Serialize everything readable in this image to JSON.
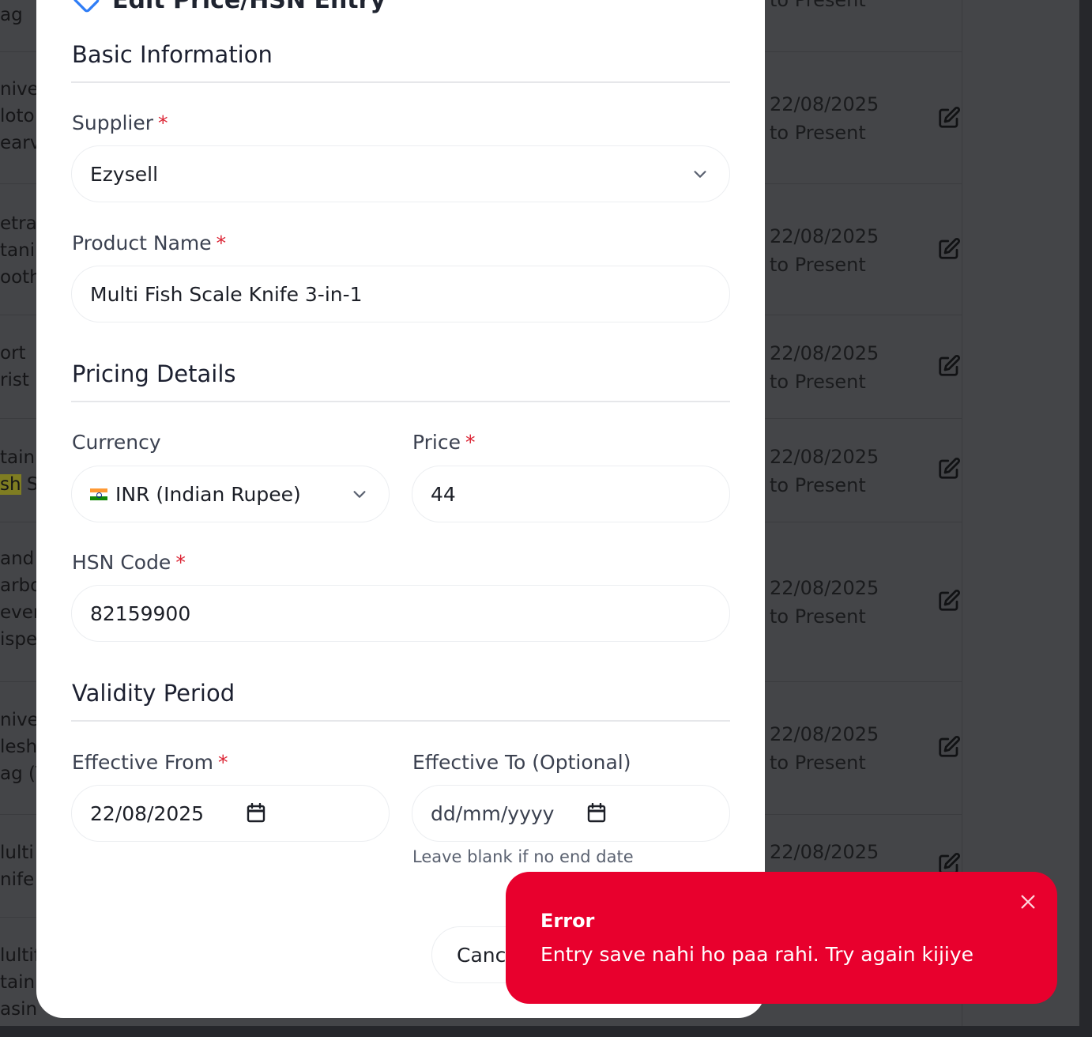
{
  "background": {
    "left_fragments": [
      {
        "lines": [
          "ag"
        ]
      },
      {
        "lines": [
          "nive",
          "loto",
          "earv"
        ]
      },
      {
        "lines": [
          "etra",
          "tani",
          "ooth"
        ]
      },
      {
        "lines": [
          "ort",
          "rist"
        ]
      },
      {
        "lines": [
          "tainl",
          "sh S"
        ],
        "highlight": "sh"
      },
      {
        "lines": [
          "and",
          "arbo",
          "ever",
          "ispe"
        ]
      },
      {
        "lines": [
          "nive",
          "lesh",
          "ag (T"
        ]
      },
      {
        "lines": [
          "lulti",
          "nife"
        ]
      },
      {
        "lines": [
          "lultif",
          "tainl",
          "asin"
        ]
      }
    ],
    "dates": [
      {
        "line1": "",
        "line2": "to Present"
      },
      {
        "line1": "22/08/2025",
        "line2": "to Present"
      },
      {
        "line1": "22/08/2025",
        "line2": "to Present"
      },
      {
        "line1": "22/08/2025",
        "line2": "to Present"
      },
      {
        "line1": "22/08/2025",
        "line2": "to Present"
      },
      {
        "line1": "22/08/2025",
        "line2": "to Present"
      },
      {
        "line1": "22/08/2025",
        "line2": "to Present"
      },
      {
        "line1": "22/08/2025",
        "line2": ""
      }
    ],
    "edit_icon": "edit-icon"
  },
  "modal": {
    "title": "Edit Price/HSN Entry",
    "title_icon": "tag-icon",
    "sections": {
      "basic": "Basic Information",
      "pricing": "Pricing Details",
      "validity": "Validity Period"
    },
    "supplier": {
      "label": "Supplier",
      "required": "*",
      "value": "Ezysell"
    },
    "product_name": {
      "label": "Product Name",
      "required": "*",
      "value": "Multi Fish Scale Knife 3-in-1"
    },
    "currency": {
      "label": "Currency",
      "value": "INR (Indian Rupee)",
      "flag": "india-flag-icon"
    },
    "price": {
      "label": "Price",
      "required": "*",
      "value": "44"
    },
    "hsn_code": {
      "label": "HSN Code",
      "required": "*",
      "value": "82159900"
    },
    "effective_from": {
      "label": "Effective From",
      "required": "*",
      "value": "22/08/2025"
    },
    "effective_to": {
      "label": "Effective To (Optional)",
      "placeholder": "dd/mm/yyyy",
      "hint": "Leave blank if no end date"
    },
    "cancel_label": "Cancel"
  },
  "toast": {
    "title": "Error",
    "message": "Entry save nahi ho paa rahi. Try again kijiye",
    "accent": "#e8002d"
  }
}
